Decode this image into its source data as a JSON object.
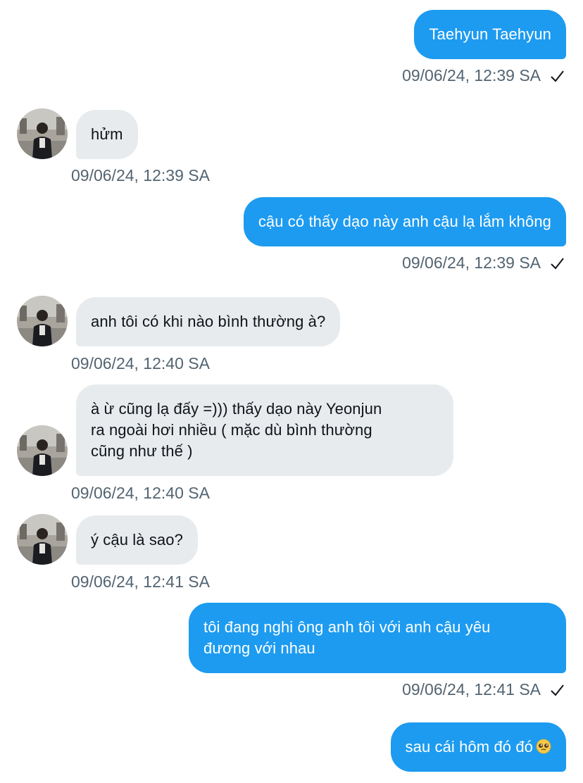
{
  "colors": {
    "outgoing_bubble": "#1d9bf0",
    "incoming_bubble": "#e8ebed",
    "timestamp": "#536471"
  },
  "messages": [
    {
      "direction": "outgoing",
      "text": "Taehyun Taehyun",
      "timestamp": "09/06/24, 12:39 SA",
      "status": "check-icon"
    },
    {
      "direction": "incoming",
      "text": "hửm",
      "timestamp": "09/06/24, 12:39 SA"
    },
    {
      "direction": "outgoing",
      "text": "cậu có thấy dạo này anh cậu lạ lắm không",
      "timestamp": "09/06/24, 12:39 SA",
      "status": "check-icon"
    },
    {
      "direction": "incoming",
      "text": "anh tôi có khi nào bình thường à?",
      "timestamp": "09/06/24, 12:40 SA"
    },
    {
      "direction": "incoming",
      "text": "à ừ cũng lạ đấy =))) thấy dạo này Yeonjun\nra ngoài hơi nhiều ( mặc dù bình thường\ncũng như thế )",
      "timestamp": "09/06/24, 12:40 SA"
    },
    {
      "direction": "incoming",
      "text": "ý cậu là sao?",
      "timestamp": "09/06/24, 12:41 SA"
    },
    {
      "direction": "outgoing",
      "text": "tôi đang nghi ông anh tôi với anh cậu yêu\nđương với nhau",
      "timestamp": "09/06/24, 12:41 SA",
      "status": "check-icon"
    },
    {
      "direction": "outgoing",
      "text": "sau cái hôm đó đó",
      "emoji": "pleading-face-emoji"
    }
  ]
}
